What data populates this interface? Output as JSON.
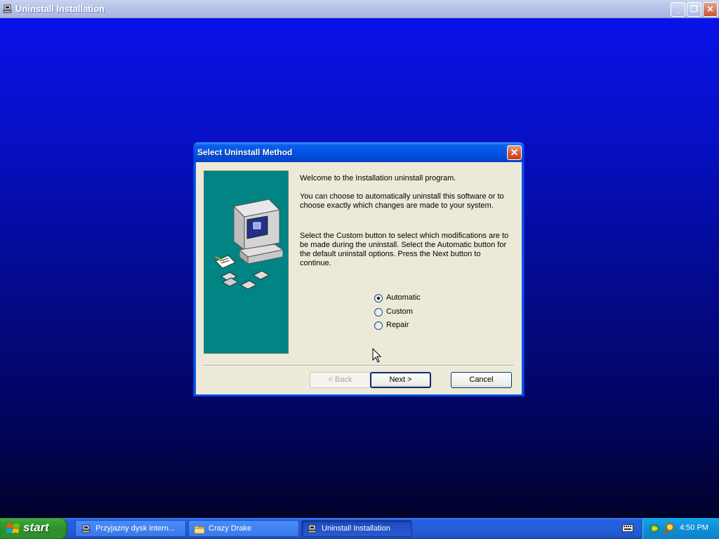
{
  "window": {
    "title": "Uninstall  Installation",
    "controls": {
      "minimize": "_",
      "restore": "❐",
      "close": "✕"
    }
  },
  "dialog": {
    "title": "Select Uninstall Method",
    "close_glyph": "✕",
    "welcome": "Welcome to the  Installation uninstall program.",
    "intro": "You can choose to automatically uninstall this software or to choose exactly which changes are made to your system.",
    "instructions": "Select the Custom button to select which modifications are to be made during the uninstall. Select the Automatic button for the default uninstall options. Press the Next button to continue.",
    "options": [
      {
        "label": "Automatic",
        "checked": true
      },
      {
        "label": "Custom",
        "checked": false
      },
      {
        "label": "Repair",
        "checked": false
      }
    ],
    "buttons": {
      "back": "< Back",
      "next": "Next >",
      "cancel": "Cancel"
    }
  },
  "taskbar": {
    "start_label": "start",
    "tasks": [
      {
        "label": "Przyjazny dysk intern...",
        "icon": "installer-icon",
        "active": false
      },
      {
        "label": "Crazy Drake",
        "icon": "folder-icon",
        "active": false
      },
      {
        "label": "Uninstall  Installation",
        "icon": "installer-icon",
        "active": true
      }
    ],
    "clock": "4:50 PM"
  },
  "colors": {
    "desktop_top": "#0a12ee",
    "desktop_bottom": "#01022a",
    "dialog_face": "#ece9d8",
    "side_panel": "#008484",
    "xp_blue": "#0055e5"
  }
}
